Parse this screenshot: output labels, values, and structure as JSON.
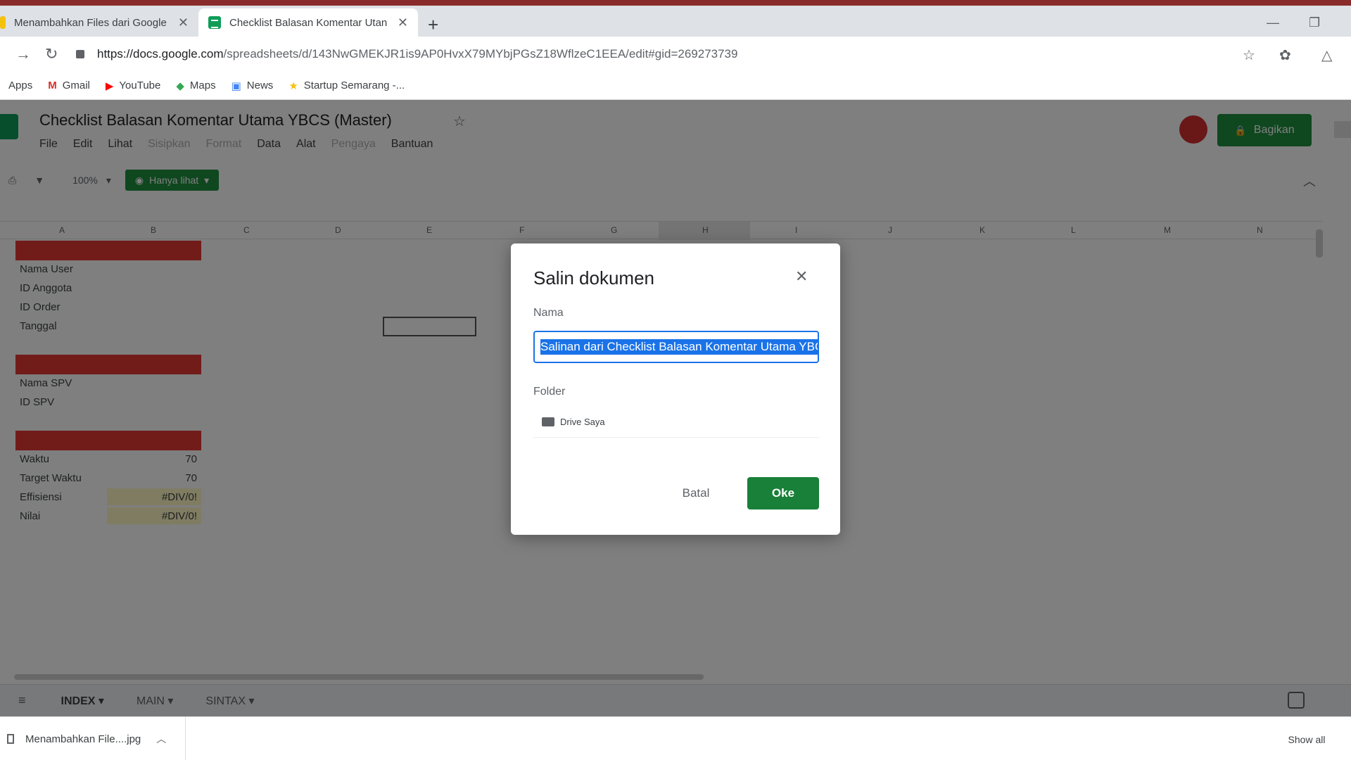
{
  "browser": {
    "tabs": [
      {
        "title": "Menambahkan Files dari Google",
        "active": false
      },
      {
        "title": "Checklist Balasan Komentar Utan",
        "active": true
      }
    ],
    "url_host": "https://docs.google.com",
    "url_path": "/spreadsheets/d/143NwGMEKJR1is9AP0HvxX79MYbjPGsZ18WflzeC1EEA/edit#gid=269273739",
    "bookmarks": [
      {
        "label": "Apps",
        "icon": "apps-icon"
      },
      {
        "label": "Gmail",
        "icon": "gmail-icon"
      },
      {
        "label": "YouTube",
        "icon": "youtube-icon"
      },
      {
        "label": "Maps",
        "icon": "maps-icon"
      },
      {
        "label": "News",
        "icon": "news-icon"
      },
      {
        "label": "Startup Semarang -...",
        "icon": "star-icon"
      }
    ]
  },
  "sheets": {
    "title": "Checklist Balasan Komentar Utama YBCS (Master)",
    "menu": [
      "File",
      "Edit",
      "Lihat",
      "Sisipkan",
      "Format",
      "Data",
      "Alat",
      "Pengaya",
      "Bantuan"
    ],
    "menu_disabled": [
      false,
      false,
      false,
      true,
      true,
      false,
      false,
      true,
      false
    ],
    "share_label": "Bagikan",
    "zoom": "100%",
    "view_only_label": "Hanya lihat",
    "col_headers": [
      "A",
      "B",
      "C",
      "D",
      "E",
      "F",
      "G",
      "H",
      "I",
      "J",
      "K",
      "L",
      "M",
      "N"
    ],
    "section1": [
      "Nama User",
      "ID Anggota",
      "ID Order",
      "Tanggal"
    ],
    "section2": [
      "Nama SPV",
      "ID SPV"
    ],
    "section3": [
      {
        "label": "Waktu",
        "value": "70"
      },
      {
        "label": "Target Waktu",
        "value": "70"
      },
      {
        "label": "Effisiensi",
        "value": "#DIV/0!"
      },
      {
        "label": "Nilai",
        "value": "#DIV/0!"
      }
    ],
    "sheet_tabs": [
      "INDEX",
      "MAIN",
      "SINTAX"
    ],
    "active_sheet": "INDEX"
  },
  "dialog": {
    "title": "Salin dokumen",
    "name_label": "Nama",
    "name_value": "Salinan dari Checklist Balasan Komentar Utama YBCS (Master)",
    "folder_label": "Folder",
    "folder_value": "Drive Saya",
    "cancel_label": "Batal",
    "ok_label": "Oke"
  },
  "downloads": {
    "item": "Menambahkan File....jpg",
    "show_all": "Show all"
  },
  "colors": {
    "accent_green": "#188038",
    "selection_blue": "#1a73e8",
    "section_red": "#e53935"
  }
}
